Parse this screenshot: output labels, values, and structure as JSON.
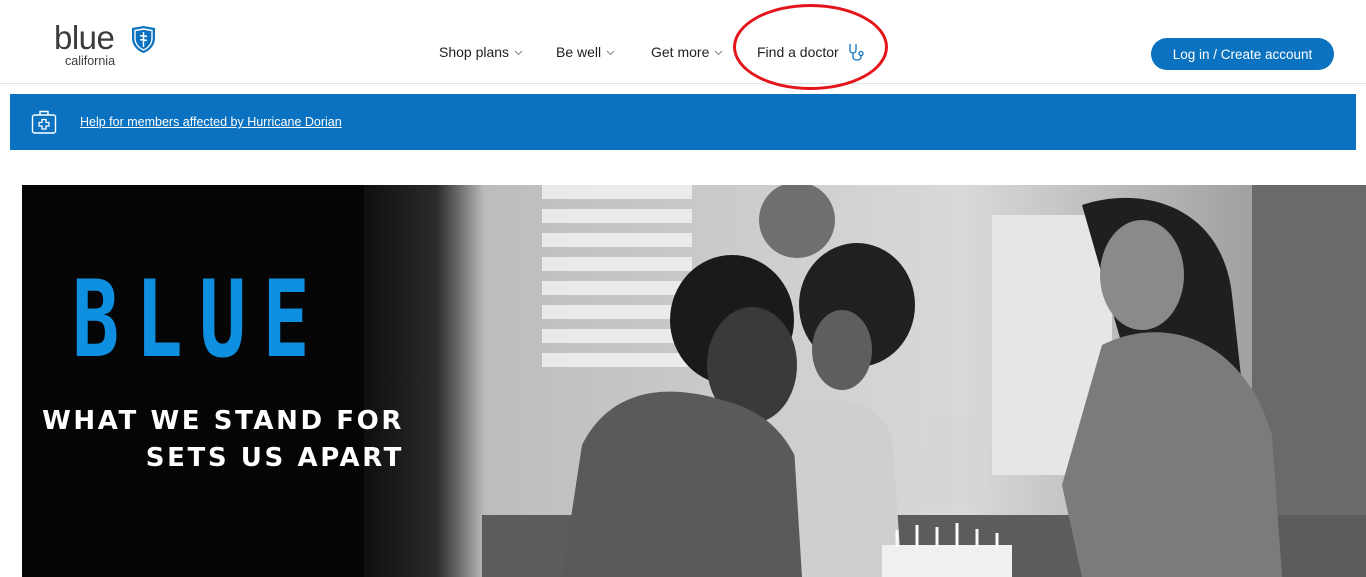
{
  "header": {
    "logo": {
      "word": "blue",
      "sub": "california"
    },
    "nav": [
      {
        "label": "Shop plans",
        "has_menu": true
      },
      {
        "label": "Be well",
        "has_menu": true
      },
      {
        "label": "Get more",
        "has_menu": true
      },
      {
        "label": "Find a doctor",
        "icon": "stethoscope-icon"
      }
    ],
    "login_label": "Log in / Create account"
  },
  "alert": {
    "icon": "first-aid-kit-icon",
    "link_text": "Help for members affected by Hurricane Dorian"
  },
  "hero": {
    "headline": "BLUE",
    "line1": "WHAT WE STAND FOR",
    "line2": "SETS US APART"
  },
  "colors": {
    "brand_blue": "#0a72bf",
    "hero_blue": "#0e8fe0",
    "annotation_red": "#e4141b"
  }
}
